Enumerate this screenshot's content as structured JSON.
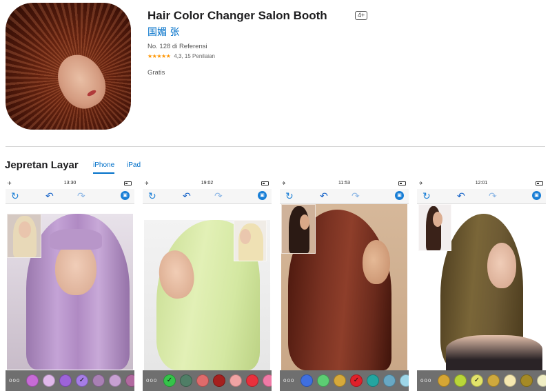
{
  "app": {
    "title": "Hair Color Changer Salon Booth",
    "age_rating": "4+",
    "developer": "国媚 张",
    "rank": "No. 128 di Referensi",
    "stars": "★★★★★",
    "rating_text": "4,3, 15 Penilaian",
    "price": "Gratis"
  },
  "screenshots_section": {
    "title": "Jepretan Layar",
    "tabs": [
      {
        "label": "iPhone",
        "selected": true
      },
      {
        "label": "iPad",
        "selected": false
      }
    ]
  },
  "screenshots": [
    {
      "time": "13:30",
      "hair_color": "#b28fc4",
      "palette": [
        "#c76bd6",
        "#e0b8ea",
        "#9d63d9",
        "#a67de6",
        "#a980b4",
        "#c7a0d2",
        "#b26aa0"
      ],
      "selected_swatch_index": 3
    },
    {
      "time": "19:02",
      "hair_color": "#d9ecaa",
      "palette": [
        "#35c44a",
        "#4f7e66",
        "#e06b6b",
        "#a5201e",
        "#f0a3a3",
        "#e8303c",
        "#f07aa6"
      ],
      "selected_swatch_index": 0
    },
    {
      "time": "11:53",
      "hair_color": "#6a2a1c",
      "palette": [
        "#3f6fe0",
        "#5ccd73",
        "#d6a93a",
        "#e0202a",
        "#23a5a0",
        "#68a8c4",
        "#9ed6e8"
      ],
      "selected_swatch_index": 3
    },
    {
      "time": "12:01",
      "hair_color": "#6d5a34",
      "palette": [
        "#d6a634",
        "#b9d638",
        "#e2e36a",
        "#cfa93d",
        "#f5e8b0",
        "#a58a26",
        "#f0eec4"
      ],
      "selected_swatch_index": 2
    }
  ],
  "icons": {
    "reset": "↻",
    "undo": "↶",
    "redo": "↷",
    "photo": "▣",
    "airplane": "✈",
    "more": "ooo",
    "check": "✓"
  }
}
